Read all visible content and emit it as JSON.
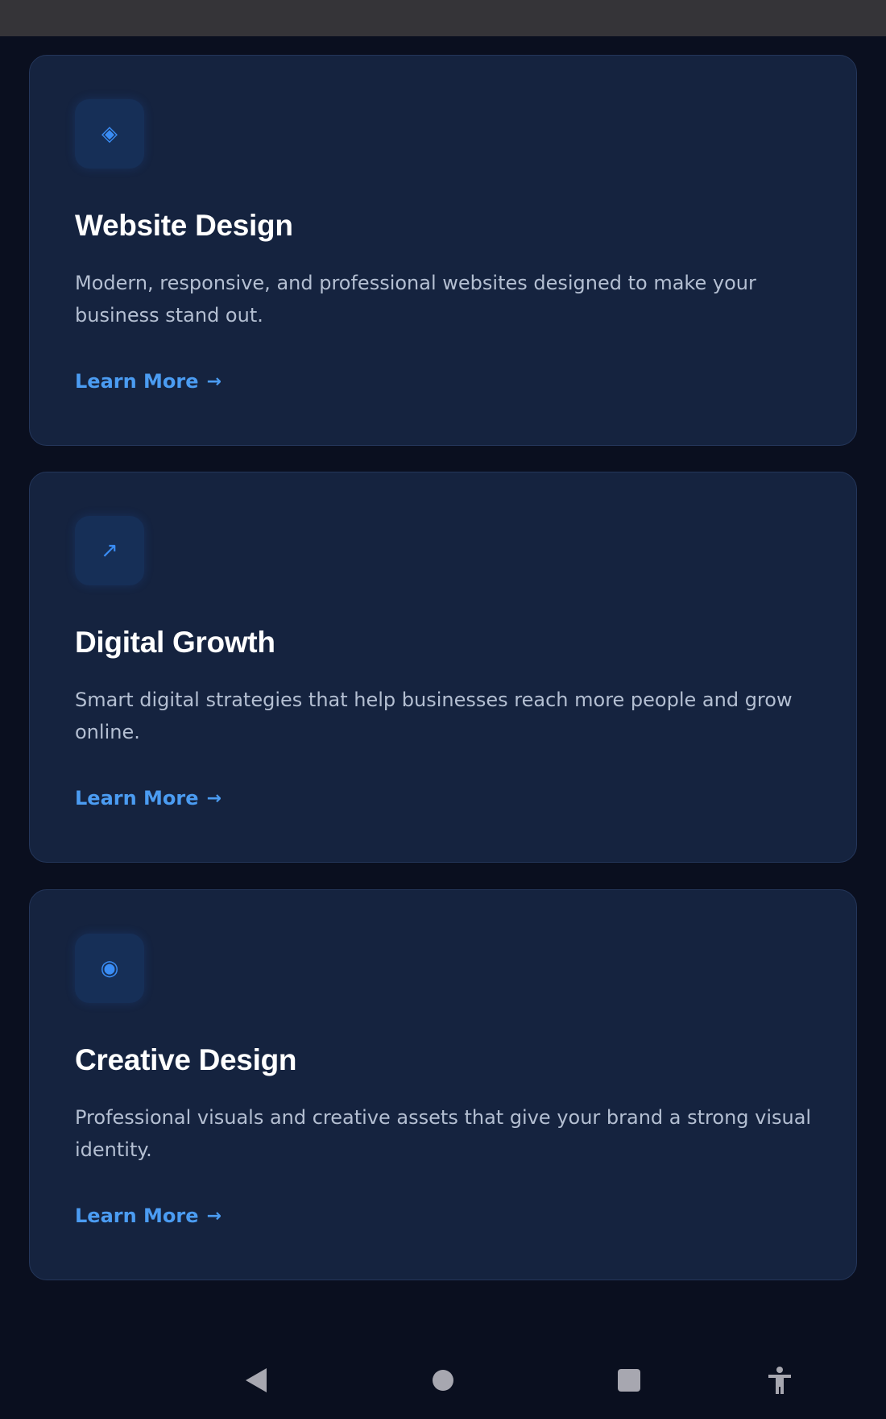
{
  "cards": [
    {
      "icon": "diamond-icon",
      "icon_glyph": "◈",
      "title": "Website Design",
      "description": "Modern, responsive, and professional websites designed to make your business stand out.",
      "link_label": "Learn More",
      "link_arrow": "→"
    },
    {
      "icon": "trend-arrow-icon",
      "icon_glyph": "↗",
      "title": "Digital Growth",
      "description": "Smart digital strategies that help businesses reach more people and grow online.",
      "link_label": "Learn More",
      "link_arrow": "→"
    },
    {
      "icon": "target-circle-icon",
      "icon_glyph": "◉",
      "title": "Creative Design",
      "description": "Professional visuals and creative assets that give your brand a strong visual identity.",
      "link_label": "Learn More",
      "link_arrow": "→"
    }
  ],
  "nav_bar": {
    "back": "back-icon",
    "home": "home-icon",
    "recents": "recents-icon",
    "accessibility": "accessibility-icon"
  },
  "colors": {
    "background": "#0a0f1f",
    "card": "#15233f",
    "accent": "#4b9cf2",
    "title": "#ffffff",
    "body_text": "#b4bfd2",
    "status_bar": "#353438"
  }
}
